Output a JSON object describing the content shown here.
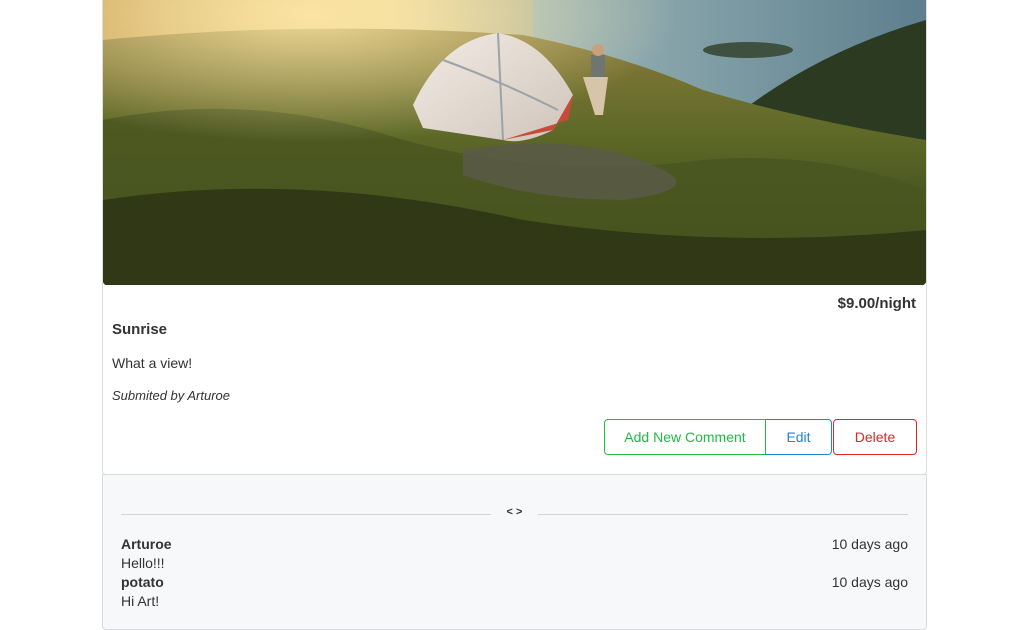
{
  "campground": {
    "price": "$9.00/night",
    "name": "Sunrise",
    "description": "What a view!",
    "submitted_by": "Submited by Arturoe"
  },
  "actions": {
    "add_comment": "Add New Comment",
    "edit": "Edit",
    "delete": "Delete"
  },
  "comments_section": {
    "divider_label": "< >",
    "comments": [
      {
        "author": "Arturoe",
        "time": "10 days ago",
        "text": "Hello!!!"
      },
      {
        "author": "potato",
        "time": "10 days ago",
        "text": "Hi Art!"
      }
    ]
  },
  "colors": {
    "add_comment": "#21ba45",
    "edit": "#2185d0",
    "delete": "#db2828"
  }
}
